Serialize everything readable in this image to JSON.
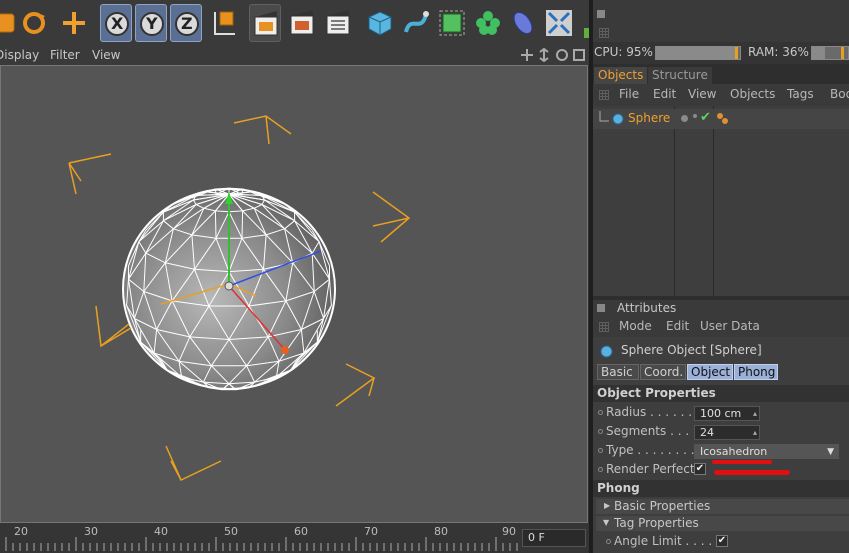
{
  "viewport_menu": [
    "Display",
    "Filter",
    "View"
  ],
  "toolbar": {
    "axis_x": "X",
    "axis_y": "Y",
    "axis_z": "Z"
  },
  "status": {
    "cpu_label": "CPU: 95%",
    "cpu_value": 0.95,
    "ram_label": "RAM: 36%",
    "ram_value": 0.36
  },
  "object_manager": {
    "tabs": [
      "Objects",
      "Structure"
    ],
    "menu": [
      "File",
      "Edit",
      "View",
      "Objects",
      "Tags",
      "Boo"
    ],
    "object_name": "Sphere"
  },
  "attributes": {
    "title": "Attributes",
    "menu": [
      "Mode",
      "Edit",
      "User Data"
    ],
    "object_title": "Sphere Object [Sphere]",
    "tabs": [
      "Basic",
      "Coord.",
      "Object",
      "Phong"
    ],
    "section_object": "Object Properties",
    "radius_label": "Radius . . . . . . . .",
    "radius_value": "100 cm",
    "segments_label": "Segments . . . . .",
    "segments_value": "24",
    "type_label": "Type . . . . . . . . .",
    "type_value": "Icosahedron",
    "render_perfect_label": "Render Perfect",
    "section_phong": "Phong",
    "basic_properties": "Basic Properties",
    "tag_properties": "Tag Properties",
    "angle_limit_label": "Angle Limit . . . . . ."
  },
  "timeline": {
    "ticks": [
      "20",
      "30",
      "40",
      "50",
      "60",
      "70",
      "80",
      "90"
    ],
    "frame": "0 F"
  },
  "colors": {
    "accent": "#f0a030",
    "selection": "#5a6f92",
    "handle_orange": "#e8a020"
  }
}
